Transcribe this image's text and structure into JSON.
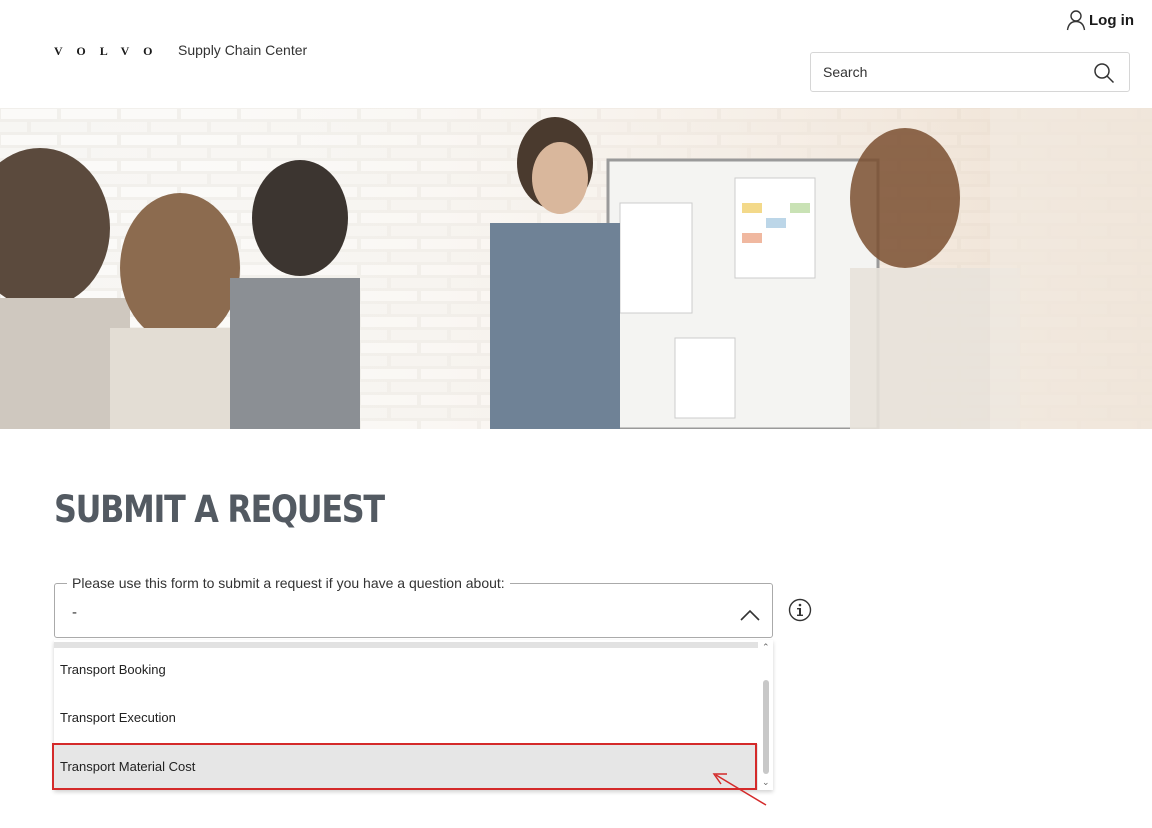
{
  "header": {
    "logo_text": "VOLVO",
    "site_name": "Supply Chain Center",
    "login_label": "Log in",
    "search": {
      "placeholder": "Search",
      "value": ""
    }
  },
  "hero": {
    "image_description_icon": "hero-image"
  },
  "main": {
    "title": "SUBMIT A REQUEST",
    "form": {
      "select_label": "Please use this form to submit a request if you have a question about:",
      "select_value": "-",
      "options": [
        {
          "label": "Transport Booking"
        },
        {
          "label": "Transport Execution"
        },
        {
          "label": "Transport Material Cost",
          "highlighted": true
        }
      ]
    }
  },
  "colors": {
    "title": "#535a62",
    "highlight": "#d42a2a",
    "selected_option_bg": "#e6e6e6"
  },
  "icons": [
    "user-icon",
    "search-icon",
    "chevron-up-icon",
    "info-icon",
    "scroll-up-icon",
    "scroll-down-icon"
  ]
}
